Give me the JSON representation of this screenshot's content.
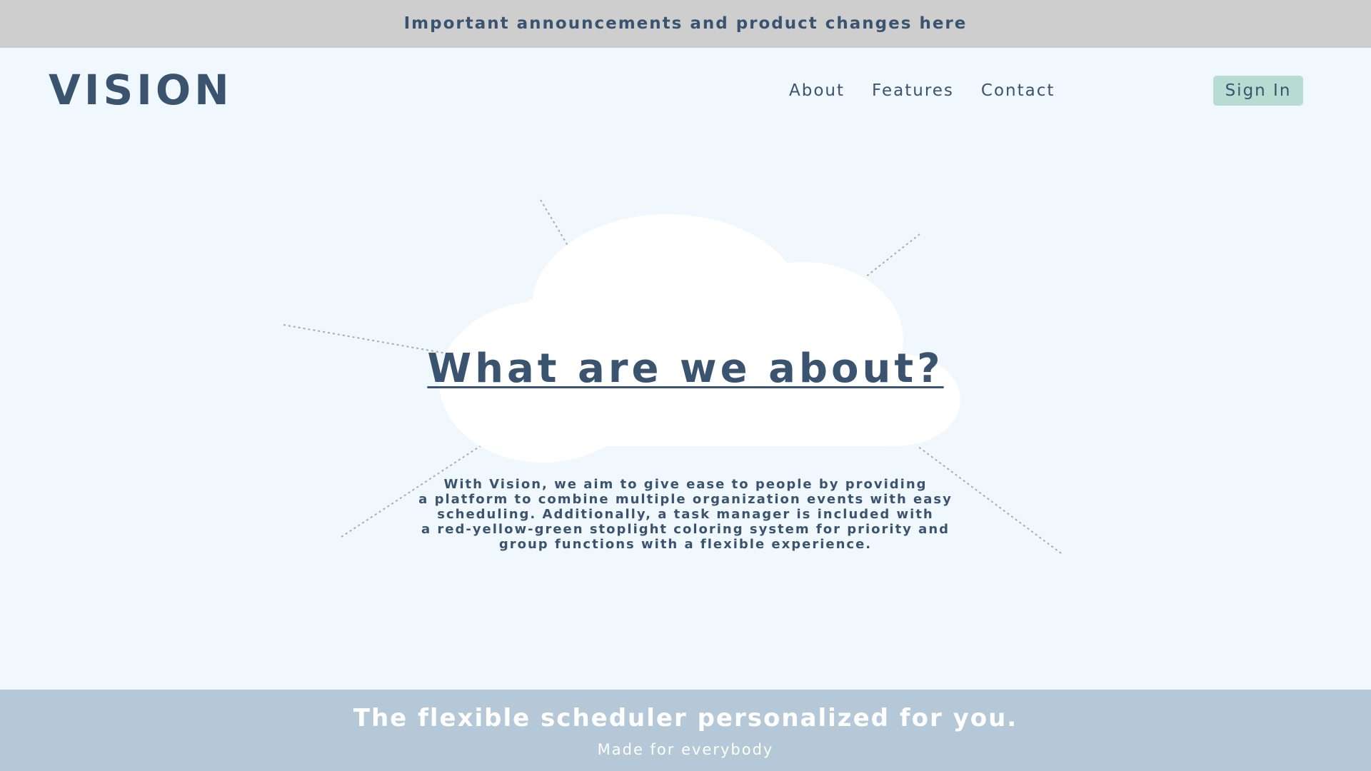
{
  "announcement": "Important announcements and product changes here",
  "header": {
    "logo": "VISION",
    "nav": [
      {
        "label": "About"
      },
      {
        "label": "Features"
      },
      {
        "label": "Contact"
      }
    ],
    "signin_label": "Sign In"
  },
  "hero": {
    "title": "What are we about?",
    "description": "With Vision, we aim to give ease to people by providing\na platform to combine multiple organization events with easy\nscheduling. Additionally, a task manager is included with\na red-yellow-green stoplight coloring system for priority and\ngroup functions with a flexible experience."
  },
  "footer": {
    "tagline": "The flexible scheduler personalized for you.",
    "subtitle": "Made for everybody"
  },
  "colors": {
    "background": "#f0f7fd",
    "announcement_bar": "#cecece",
    "text": "#3a536e",
    "signin_button": "#b7dcd1",
    "footer": "#b5c8d8",
    "cloud": "#ffffff"
  }
}
